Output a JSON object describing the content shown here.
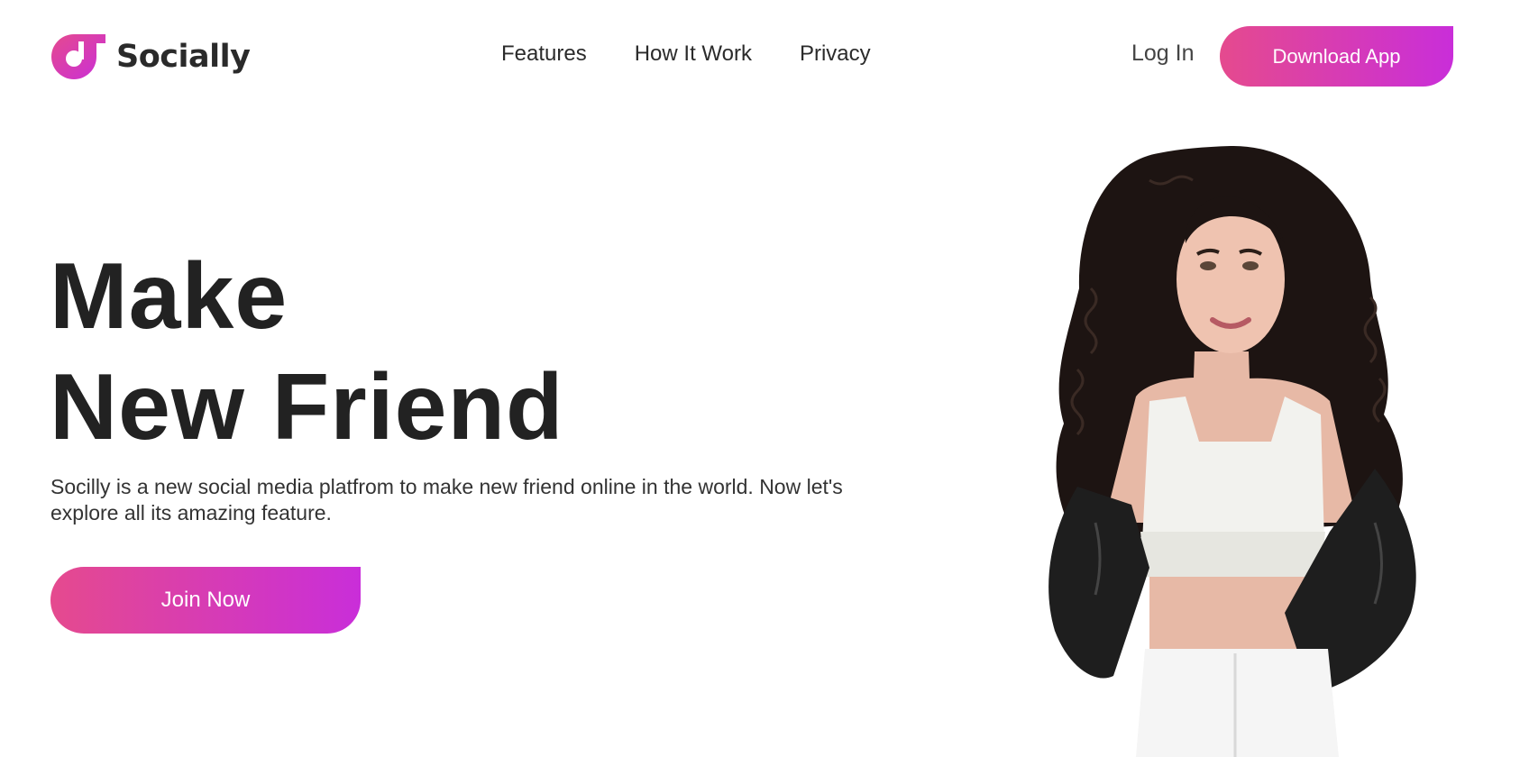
{
  "brand": {
    "name": "Socially",
    "logo_icon": "music-note-logo-icon",
    "accent_start": "#e54a8e",
    "accent_end": "#c92ed9"
  },
  "nav": {
    "items": [
      {
        "label": "Features"
      },
      {
        "label": "How It Work"
      },
      {
        "label": "Privacy"
      }
    ]
  },
  "header": {
    "login_label": "Log In",
    "download_label": "Download App"
  },
  "hero": {
    "title_line1": "Make",
    "title_line2": "New Friend",
    "description": "Socilly is a new social media platfrom to make new friend online in the world. Now let's explore all its amazing feature.",
    "cta_label": "Join Now",
    "image": "woman-with-curly-hair-photo"
  }
}
